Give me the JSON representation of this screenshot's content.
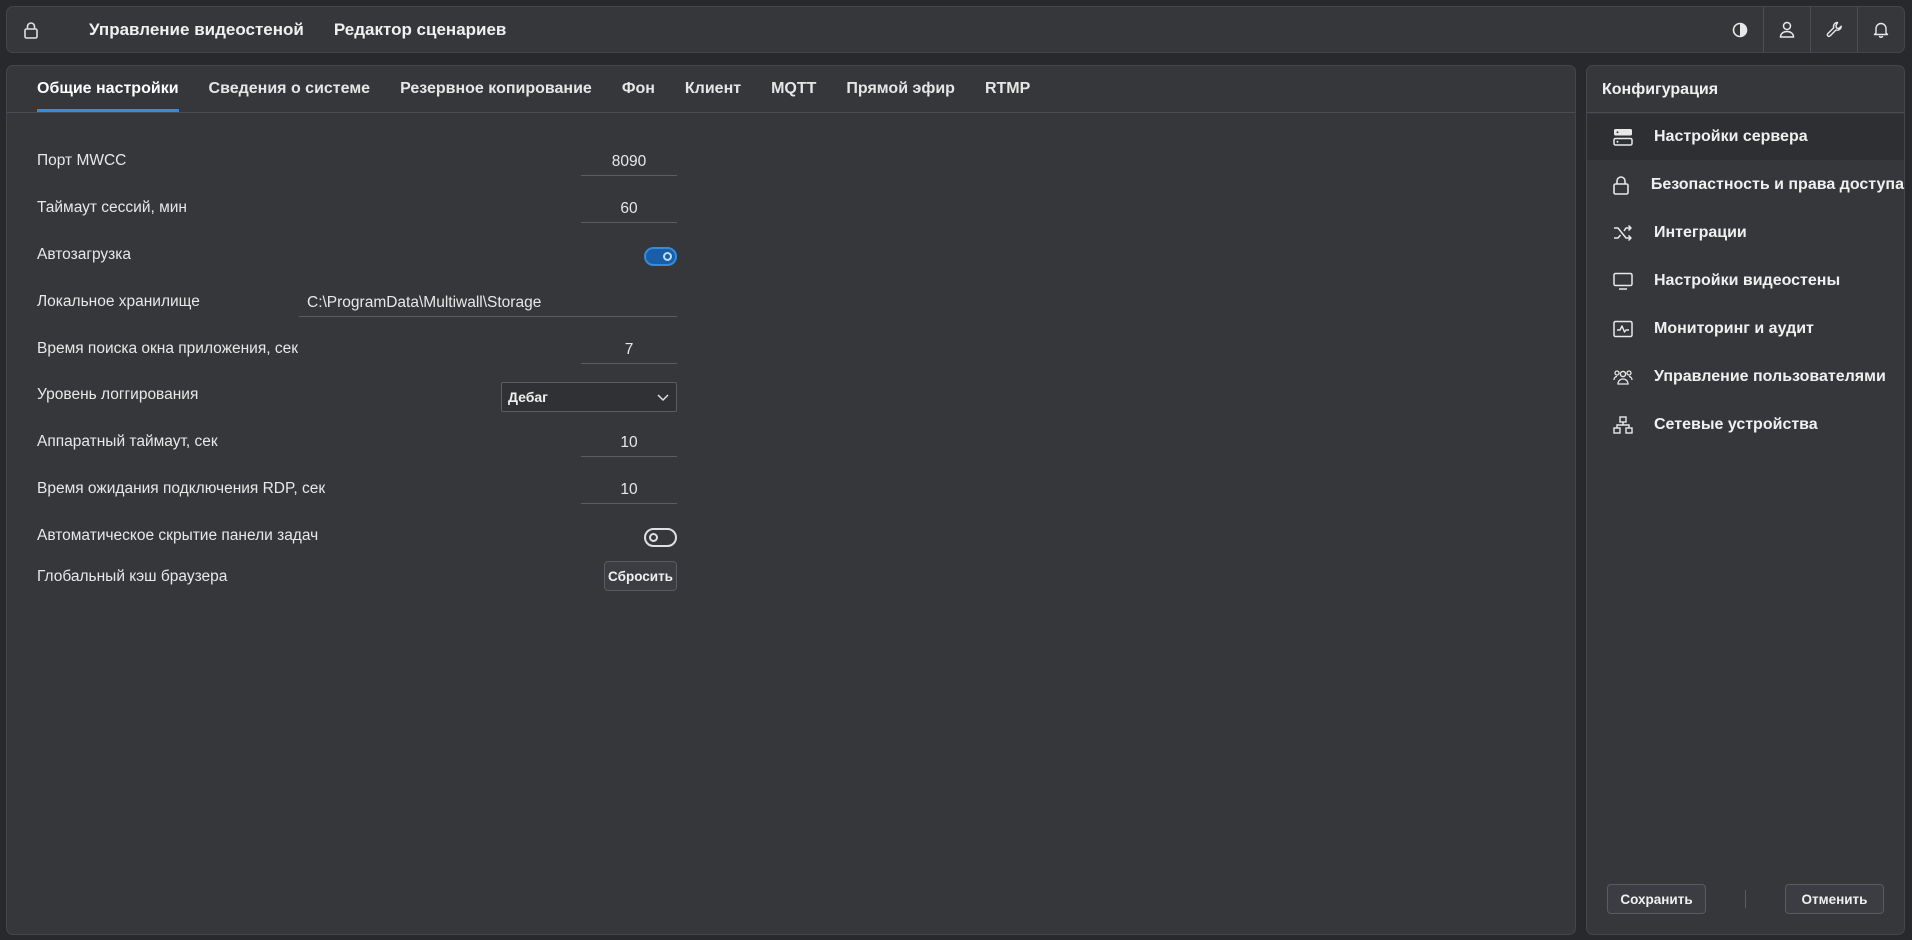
{
  "topbar": {
    "lock_icon": "lock-icon",
    "nav": [
      {
        "label": "Управление видеостеной"
      },
      {
        "label": "Редактор сценариев"
      }
    ],
    "icons": [
      "contrast-icon",
      "user-icon",
      "wrench-icon",
      "bell-icon"
    ]
  },
  "tabs": [
    {
      "label": "Общие настройки",
      "active": true
    },
    {
      "label": "Сведения о системе"
    },
    {
      "label": "Резервное копирование"
    },
    {
      "label": "Фон"
    },
    {
      "label": "Клиент"
    },
    {
      "label": "MQTT"
    },
    {
      "label": "Прямой эфир"
    },
    {
      "label": "RTMP"
    }
  ],
  "settings": {
    "port": {
      "label": "Порт MWCC",
      "value": "8090"
    },
    "session_timeout": {
      "label": "Таймаут сессий, мин",
      "value": "60"
    },
    "autoload": {
      "label": "Автозагрузка",
      "enabled": true
    },
    "storage": {
      "label": "Локальное хранилище",
      "value": "C:\\ProgramData\\Multiwall\\Storage"
    },
    "search_time": {
      "label": "Время поиска окна приложения, сек",
      "value": "7"
    },
    "log_level": {
      "label": "Уровень логгирования",
      "value": "Дебаг"
    },
    "hw_timeout": {
      "label": "Аппаратный таймаут, сек",
      "value": "10"
    },
    "rdp_timeout": {
      "label": "Время ожидания подключения RDP, сек",
      "value": "10"
    },
    "taskbar_hide": {
      "label": "Автоматическое скрытие панели задач",
      "enabled": false
    },
    "browser_cache": {
      "label": "Глобальный кэш браузера",
      "button": "Сбросить"
    }
  },
  "sidebar": {
    "title": "Конфигурация",
    "items": [
      {
        "label": "Настройки сервера",
        "icon": "server-icon",
        "active": true
      },
      {
        "label": "Безопастность и права доступа",
        "icon": "lock-icon"
      },
      {
        "label": "Интеграции",
        "icon": "shuffle-icon"
      },
      {
        "label": "Настройки видеостены",
        "icon": "monitor-icon"
      },
      {
        "label": "Мониторинг и аудит",
        "icon": "activity-icon"
      },
      {
        "label": "Управление пользователями",
        "icon": "users-icon"
      },
      {
        "label": "Сетевые устройства",
        "icon": "network-icon"
      }
    ],
    "save_label": "Сохранить",
    "cancel_label": "Отменить"
  },
  "colors": {
    "accent": "#2f8de4",
    "panel": "#36373b",
    "background": "#27292d"
  }
}
